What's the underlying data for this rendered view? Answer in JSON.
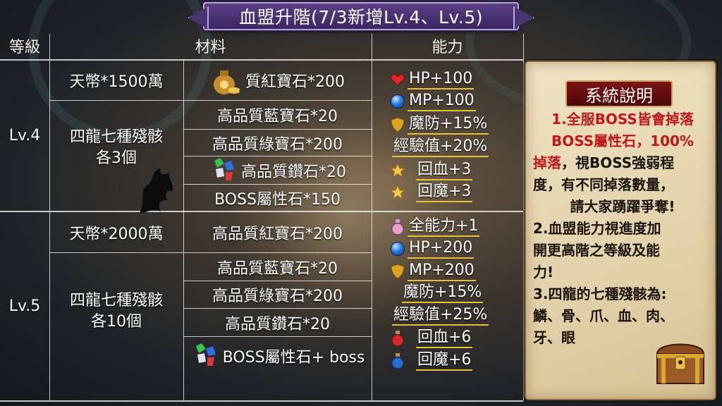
{
  "title": "血盟升階(7/3新增Lv.4、Lv.5)",
  "headers": {
    "level": "等級",
    "material": "材料",
    "ability": "能力"
  },
  "levels": [
    {
      "name": "Lv.4",
      "mat_left": [
        "天幣*1500萬",
        "四龍七種殘骸",
        "各3個"
      ],
      "mat_right": [
        "質紅寶石*200",
        "高品質藍寶石*20",
        "高品質綠寶石*200",
        "高品質鑽石*20",
        "BOSS屬性石*150"
      ],
      "abilities": [
        {
          "icon": "heart-icon",
          "text": "HP+100"
        },
        {
          "icon": "blue-orb-icon",
          "text": "MP+100"
        },
        {
          "icon": "shield-icon",
          "text": "魔防+15%"
        },
        {
          "icon": "",
          "text": "經驗值+20%"
        },
        {
          "icon": "star-icon",
          "text": "回血+3"
        },
        {
          "icon": "star-icon",
          "text": "回魔+3"
        }
      ]
    },
    {
      "name": "Lv.5",
      "mat_left": [
        "天幣*2000萬",
        "四龍七種殘骸",
        "各10個"
      ],
      "mat_right": [
        "高品質紅寶石*200",
        "高品質藍寶石*20",
        "高品質綠寶石*200",
        "高品質鑽石*20",
        "BOSS屬性石+ boss"
      ],
      "abilities": [
        {
          "icon": "potion-icon",
          "text": "全能力+1"
        },
        {
          "icon": "blue-orb-icon",
          "text": "HP+200"
        },
        {
          "icon": "shield-icon",
          "text": "MP+200"
        },
        {
          "icon": "",
          "text": "魔防+15%"
        },
        {
          "icon": "",
          "text": "經驗值+25%"
        },
        {
          "icon": "red-potion-icon",
          "text": "回血+6"
        },
        {
          "icon": "blue-potion-icon",
          "text": "回魔+6"
        }
      ]
    }
  ],
  "panel": {
    "heading": "系統說明",
    "lines": [
      "1.全服BOSS皆會掉落",
      "BOSS屬性石，100%",
      "掉落",
      "，視BOSS強弱程",
      "度，有不同掉落數量，",
      "請大家踴躍爭奪!",
      "2.血盟能力視進度加",
      "開更高階之等級及能",
      "力!",
      "3.四龍的七種殘骸為:",
      "鱗、骨、爪、血、肉、",
      "牙、眼"
    ]
  },
  "colors": {
    "accent_purple": "#5a3f86",
    "highlight_red": "#c01818",
    "underline_gold": "#e6c23a",
    "parchment": "#e3d2ab"
  }
}
